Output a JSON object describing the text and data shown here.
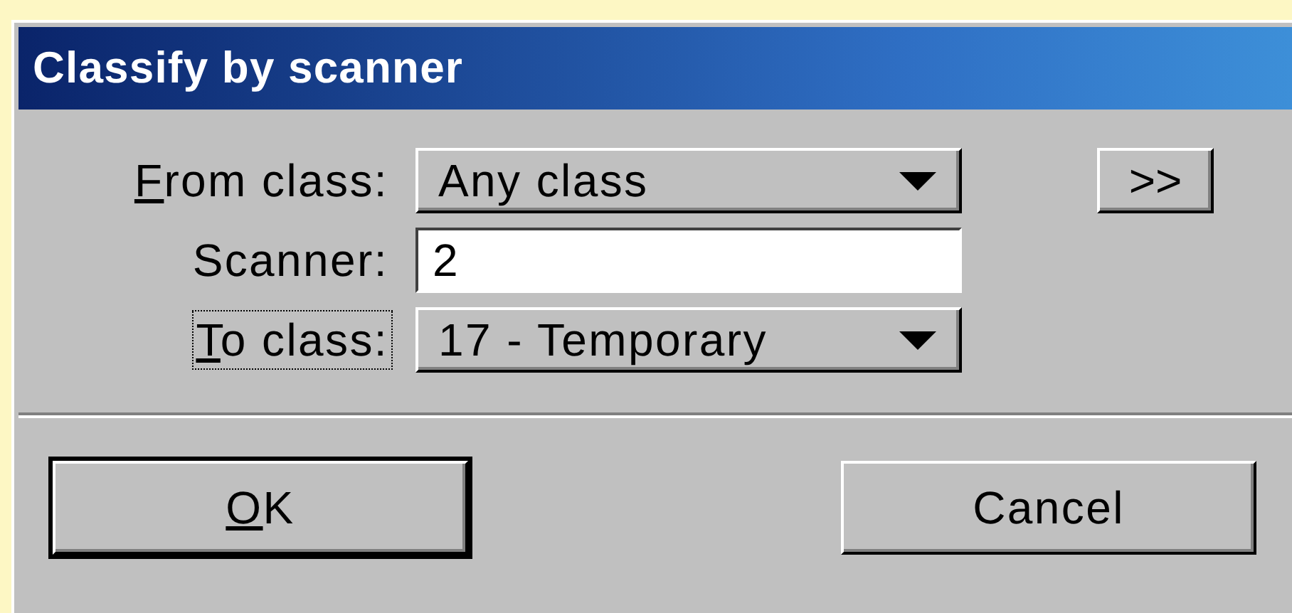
{
  "window": {
    "title": "Classify by scanner"
  },
  "fields": [
    {
      "kind": "dropdown",
      "label": "From class:",
      "underline_first": true,
      "focused": false,
      "value": "Any class"
    },
    {
      "kind": "text",
      "label": "Scanner:",
      "underline_first": false,
      "focused": false,
      "value": "2"
    },
    {
      "kind": "dropdown",
      "label": "To class:",
      "underline_first": true,
      "focused": true,
      "value": "17 - Temporary"
    }
  ],
  "more_button": {
    "label": ">>"
  },
  "buttons": [
    {
      "label": "OK",
      "underline_first": true,
      "default": true
    },
    {
      "label": "Cancel",
      "underline_first": false,
      "default": false
    }
  ]
}
